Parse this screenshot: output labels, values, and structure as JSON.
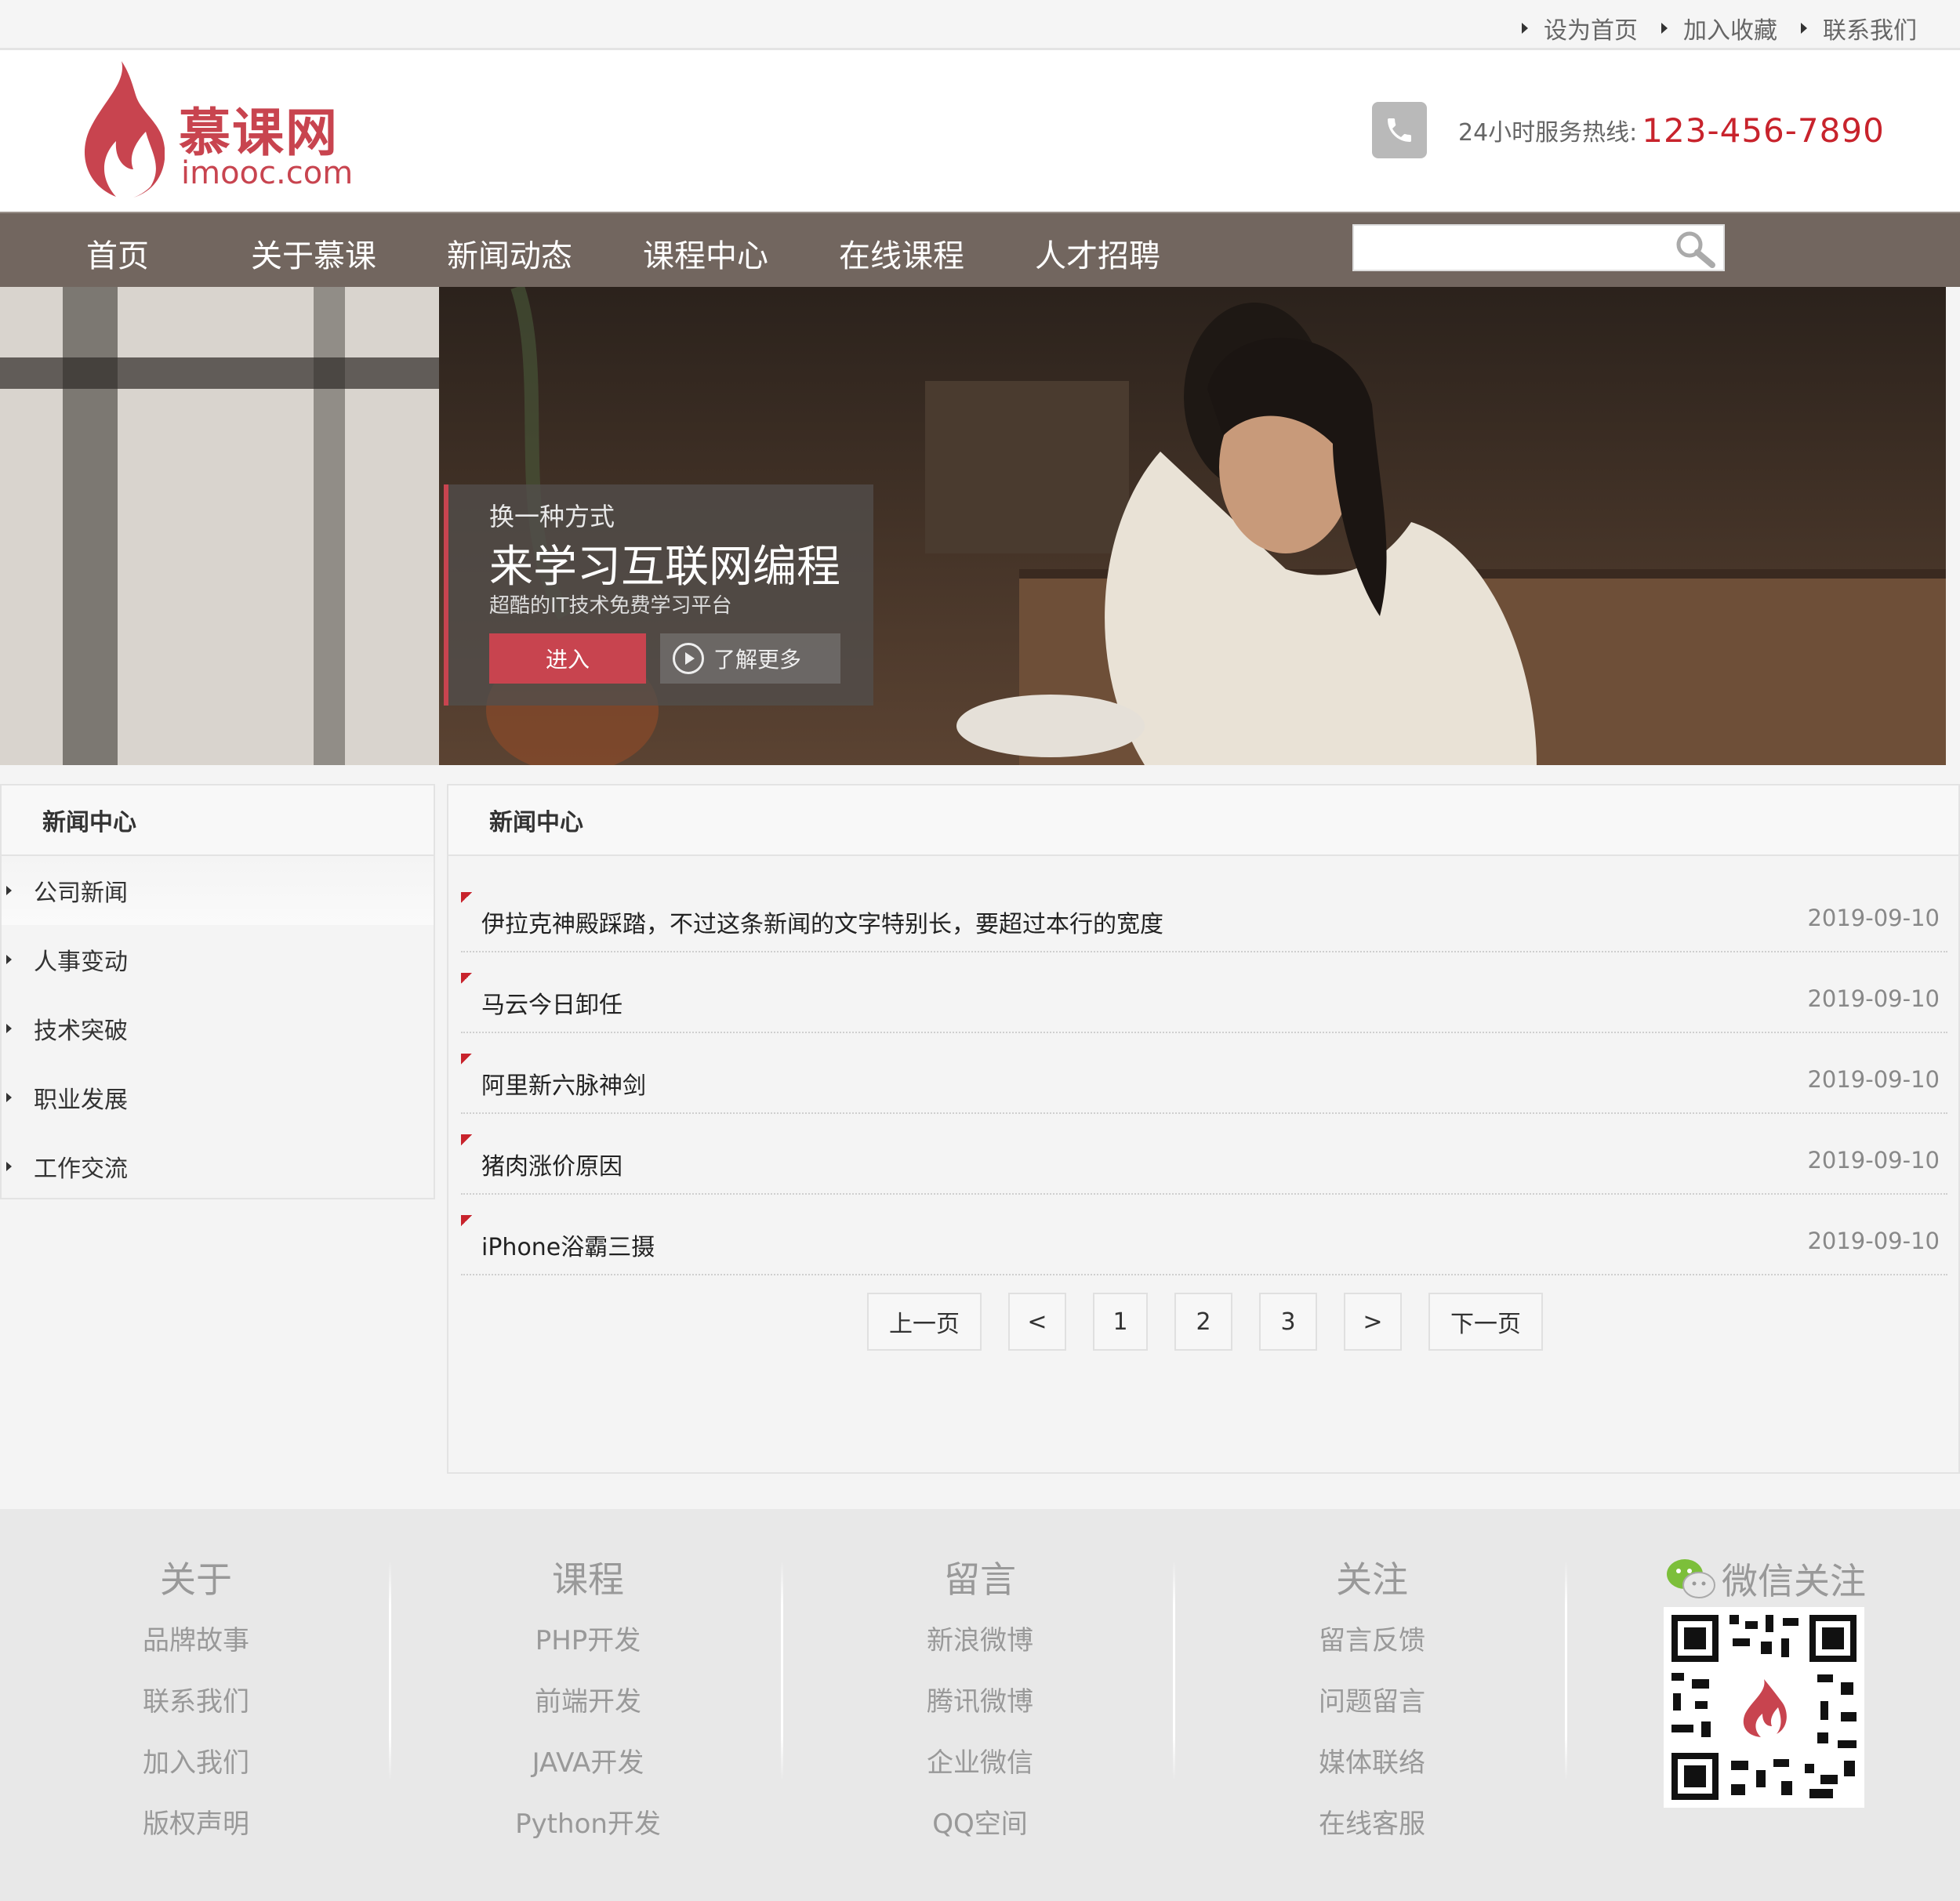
{
  "top_links": [
    "设为首页",
    "加入收藏",
    "联系我们"
  ],
  "brand": {
    "name_cn": "慕课网",
    "name_en": "imooc.com"
  },
  "hotline": {
    "label": "24小时服务热线:",
    "number": "123-456-7890"
  },
  "nav": {
    "items": [
      "首页",
      "关于慕课",
      "新闻动态",
      "课程中心",
      "在线课程",
      "人才招聘"
    ],
    "search_placeholder": ""
  },
  "banner": {
    "subtitle": "换一种方式",
    "title": "来学习互联网编程",
    "tagline": "超酷的IT技术免费学习平台",
    "enter_label": "进入",
    "more_label": "了解更多"
  },
  "sidebar": {
    "title": "新闻中心",
    "items": [
      "公司新闻",
      "人事变动",
      "技术突破",
      "职业发展",
      "工作交流"
    ]
  },
  "news": {
    "title": "新闻中心",
    "items": [
      {
        "title": "伊拉克神殿踩踏，不过这条新闻的文字特别长，要超过本行的宽度",
        "date": "2019-09-10"
      },
      {
        "title": "马云今日卸任",
        "date": "2019-09-10"
      },
      {
        "title": "阿里新六脉神剑",
        "date": "2019-09-10"
      },
      {
        "title": "猪肉涨价原因",
        "date": "2019-09-10"
      },
      {
        "title": "iPhone浴霸三摄",
        "date": "2019-09-10"
      }
    ],
    "pager": {
      "prev": "上一页",
      "prev_arrow": "<",
      "pages": [
        "1",
        "2",
        "3"
      ],
      "next_arrow": ">",
      "next": "下一页"
    }
  },
  "footer": {
    "columns": [
      {
        "title": "关于",
        "links": [
          "品牌故事",
          "联系我们",
          "加入我们",
          "版权声明"
        ]
      },
      {
        "title": "课程",
        "links": [
          "PHP开发",
          "前端开发",
          "JAVA开发",
          "Python开发"
        ]
      },
      {
        "title": "留言",
        "links": [
          "新浪微博",
          "腾讯微博",
          "企业微信",
          "QQ空间"
        ]
      },
      {
        "title": "关注",
        "links": [
          "留言反馈",
          "问题留言",
          "媒体联络",
          "在线客服"
        ]
      }
    ],
    "wechat_title": "微信关注"
  },
  "colors": {
    "brand_red": "#c8444f",
    "hotline_red": "#c8232c",
    "nav_bg": "#72665f",
    "footer_bg": "#e8e8e8"
  },
  "icons": [
    "search-icon",
    "phone-icon",
    "play-icon",
    "wechat-icon",
    "flame-logo-icon",
    "qr-code"
  ]
}
